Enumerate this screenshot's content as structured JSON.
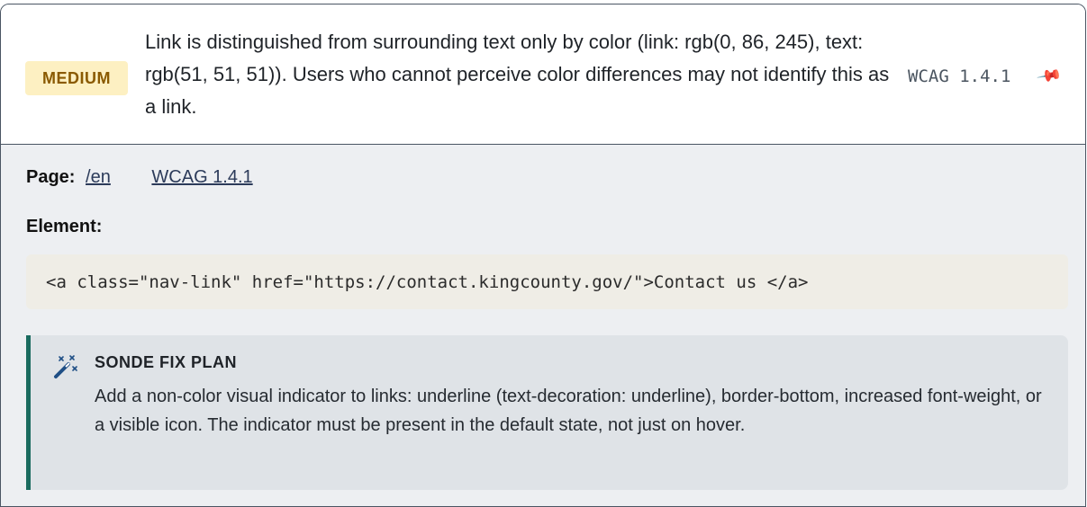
{
  "issue": {
    "severity": "MEDIUM",
    "message": "Link is distinguished from surrounding text only by color (link: rgb(0, 86, 245), text: rgb(51, 51, 51)). Users who cannot perceive color differences may not identify this as a link.",
    "wcag_tag": "WCAG 1.4.1",
    "pin_icon": "pin-icon"
  },
  "details": {
    "page_label": "Page:",
    "page_link": "/en",
    "wcag_link": "WCAG 1.4.1",
    "element_label": "Element:",
    "element_code": "<a class=\"nav-link\" href=\"https://contact.kingcounty.gov/\">Contact us </a>"
  },
  "fix": {
    "icon": "magic-wand-icon",
    "title": "SONDE FIX PLAN",
    "body": "Add a non-color visual indicator to links: underline (text-decoration: underline), border-bottom, increased font-weight, or a visible icon. The indicator must be present in the default state, not just on hover."
  },
  "colors": {
    "severity_bg": "#fdf0c2",
    "severity_text": "#8a5a00",
    "fix_accent": "#1a6b5f",
    "panel_bg": "#edeff2",
    "code_bg": "#efede6"
  }
}
